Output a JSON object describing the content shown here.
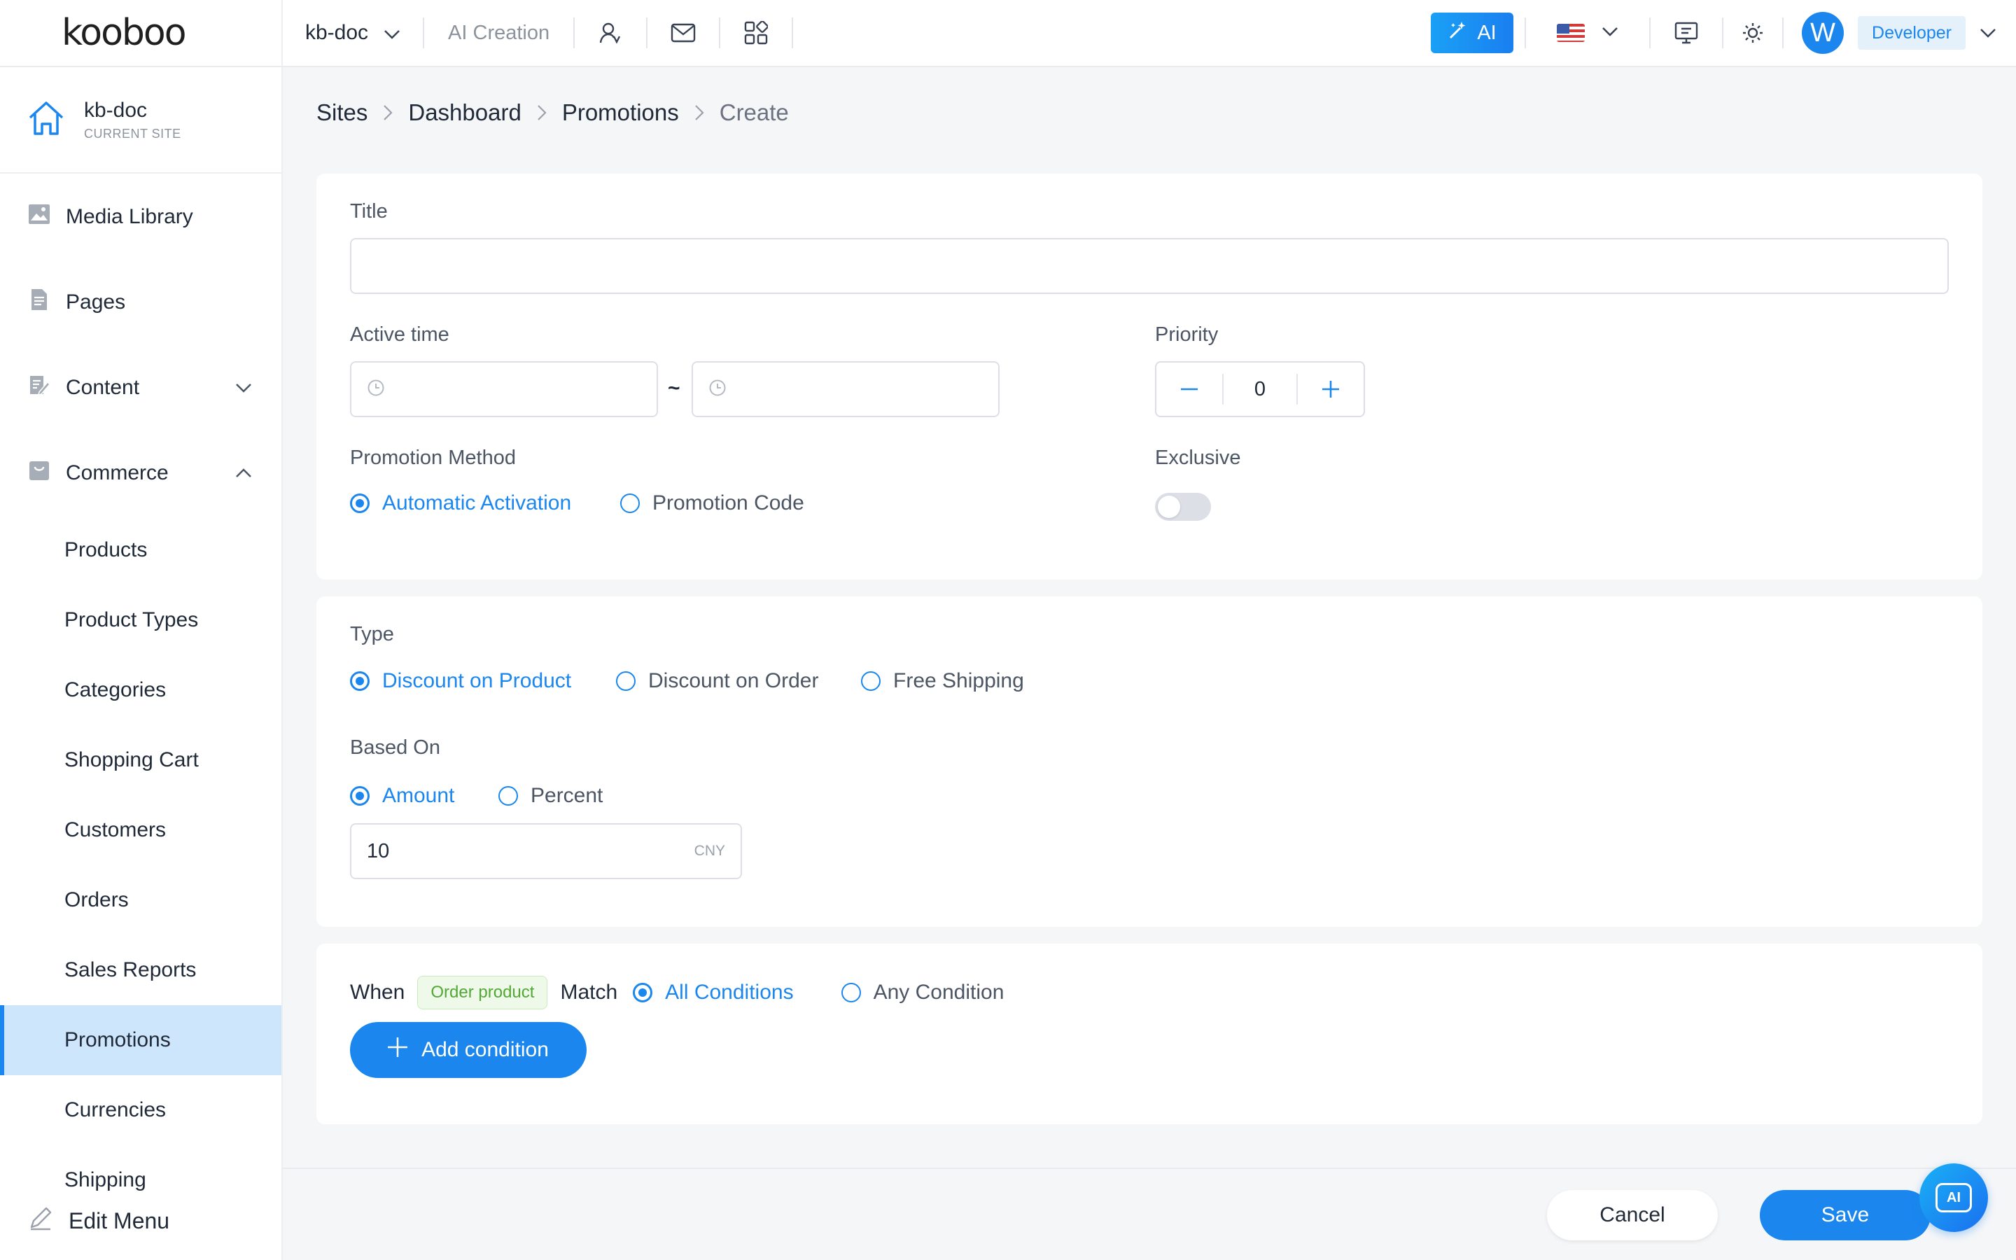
{
  "topbar": {
    "logo": "kooboo",
    "site_name": "kb-doc",
    "ai_creation": "AI Creation",
    "ai_button": "AI",
    "role": "Developer",
    "avatar_letter": "W",
    "icons": [
      "users-icon",
      "mail-icon",
      "apps-icon",
      "flag-us-icon",
      "monitor-icon",
      "sun-icon"
    ]
  },
  "sidebar": {
    "current_site": {
      "name": "kb-doc",
      "label": "CURRENT SITE"
    },
    "items": [
      {
        "label": "Media Library",
        "icon": "image-icon"
      },
      {
        "label": "Pages",
        "icon": "page-icon"
      },
      {
        "label": "Content",
        "icon": "edit-doc-icon",
        "expanded": false
      },
      {
        "label": "Commerce",
        "icon": "bag-icon",
        "expanded": true
      }
    ],
    "commerce_items": [
      "Products",
      "Product Types",
      "Categories",
      "Shopping Cart",
      "Customers",
      "Orders",
      "Sales Reports",
      "Promotions",
      "Currencies",
      "Shipping"
    ],
    "active": "Promotions",
    "edit_menu": "Edit Menu"
  },
  "breadcrumb": {
    "items": [
      "Sites",
      "Dashboard",
      "Promotions"
    ],
    "current": "Create"
  },
  "form": {
    "title_label": "Title",
    "title_value": "",
    "active_time_label": "Active time",
    "active_time_start": "",
    "active_time_end": "",
    "range_separator": "~",
    "priority_label": "Priority",
    "priority_value": "0",
    "promotion_method_label": "Promotion Method",
    "promotion_methods": [
      "Automatic Activation",
      "Promotion Code"
    ],
    "promotion_method_selected": "Automatic Activation",
    "exclusive_label": "Exclusive",
    "exclusive": false,
    "type_label": "Type",
    "types": [
      "Discount on Product",
      "Discount on Order",
      "Free Shipping"
    ],
    "type_selected": "Discount on Product",
    "based_on_label": "Based On",
    "based_on_options": [
      "Amount",
      "Percent"
    ],
    "based_on_selected": "Amount",
    "amount_value": "10",
    "amount_currency": "CNY"
  },
  "conditions": {
    "when_label": "When",
    "target_tag": "Order product",
    "match_label": "Match",
    "match_options": [
      "All Conditions",
      "Any Condition"
    ],
    "match_selected": "All Conditions",
    "add_button": "Add condition"
  },
  "footer": {
    "cancel": "Cancel",
    "save": "Save",
    "ai_fab": "AI"
  },
  "colors": {
    "accent": "#1a86ee",
    "active_nav_bg": "#cde6fb",
    "tag_green": "#52a834"
  }
}
